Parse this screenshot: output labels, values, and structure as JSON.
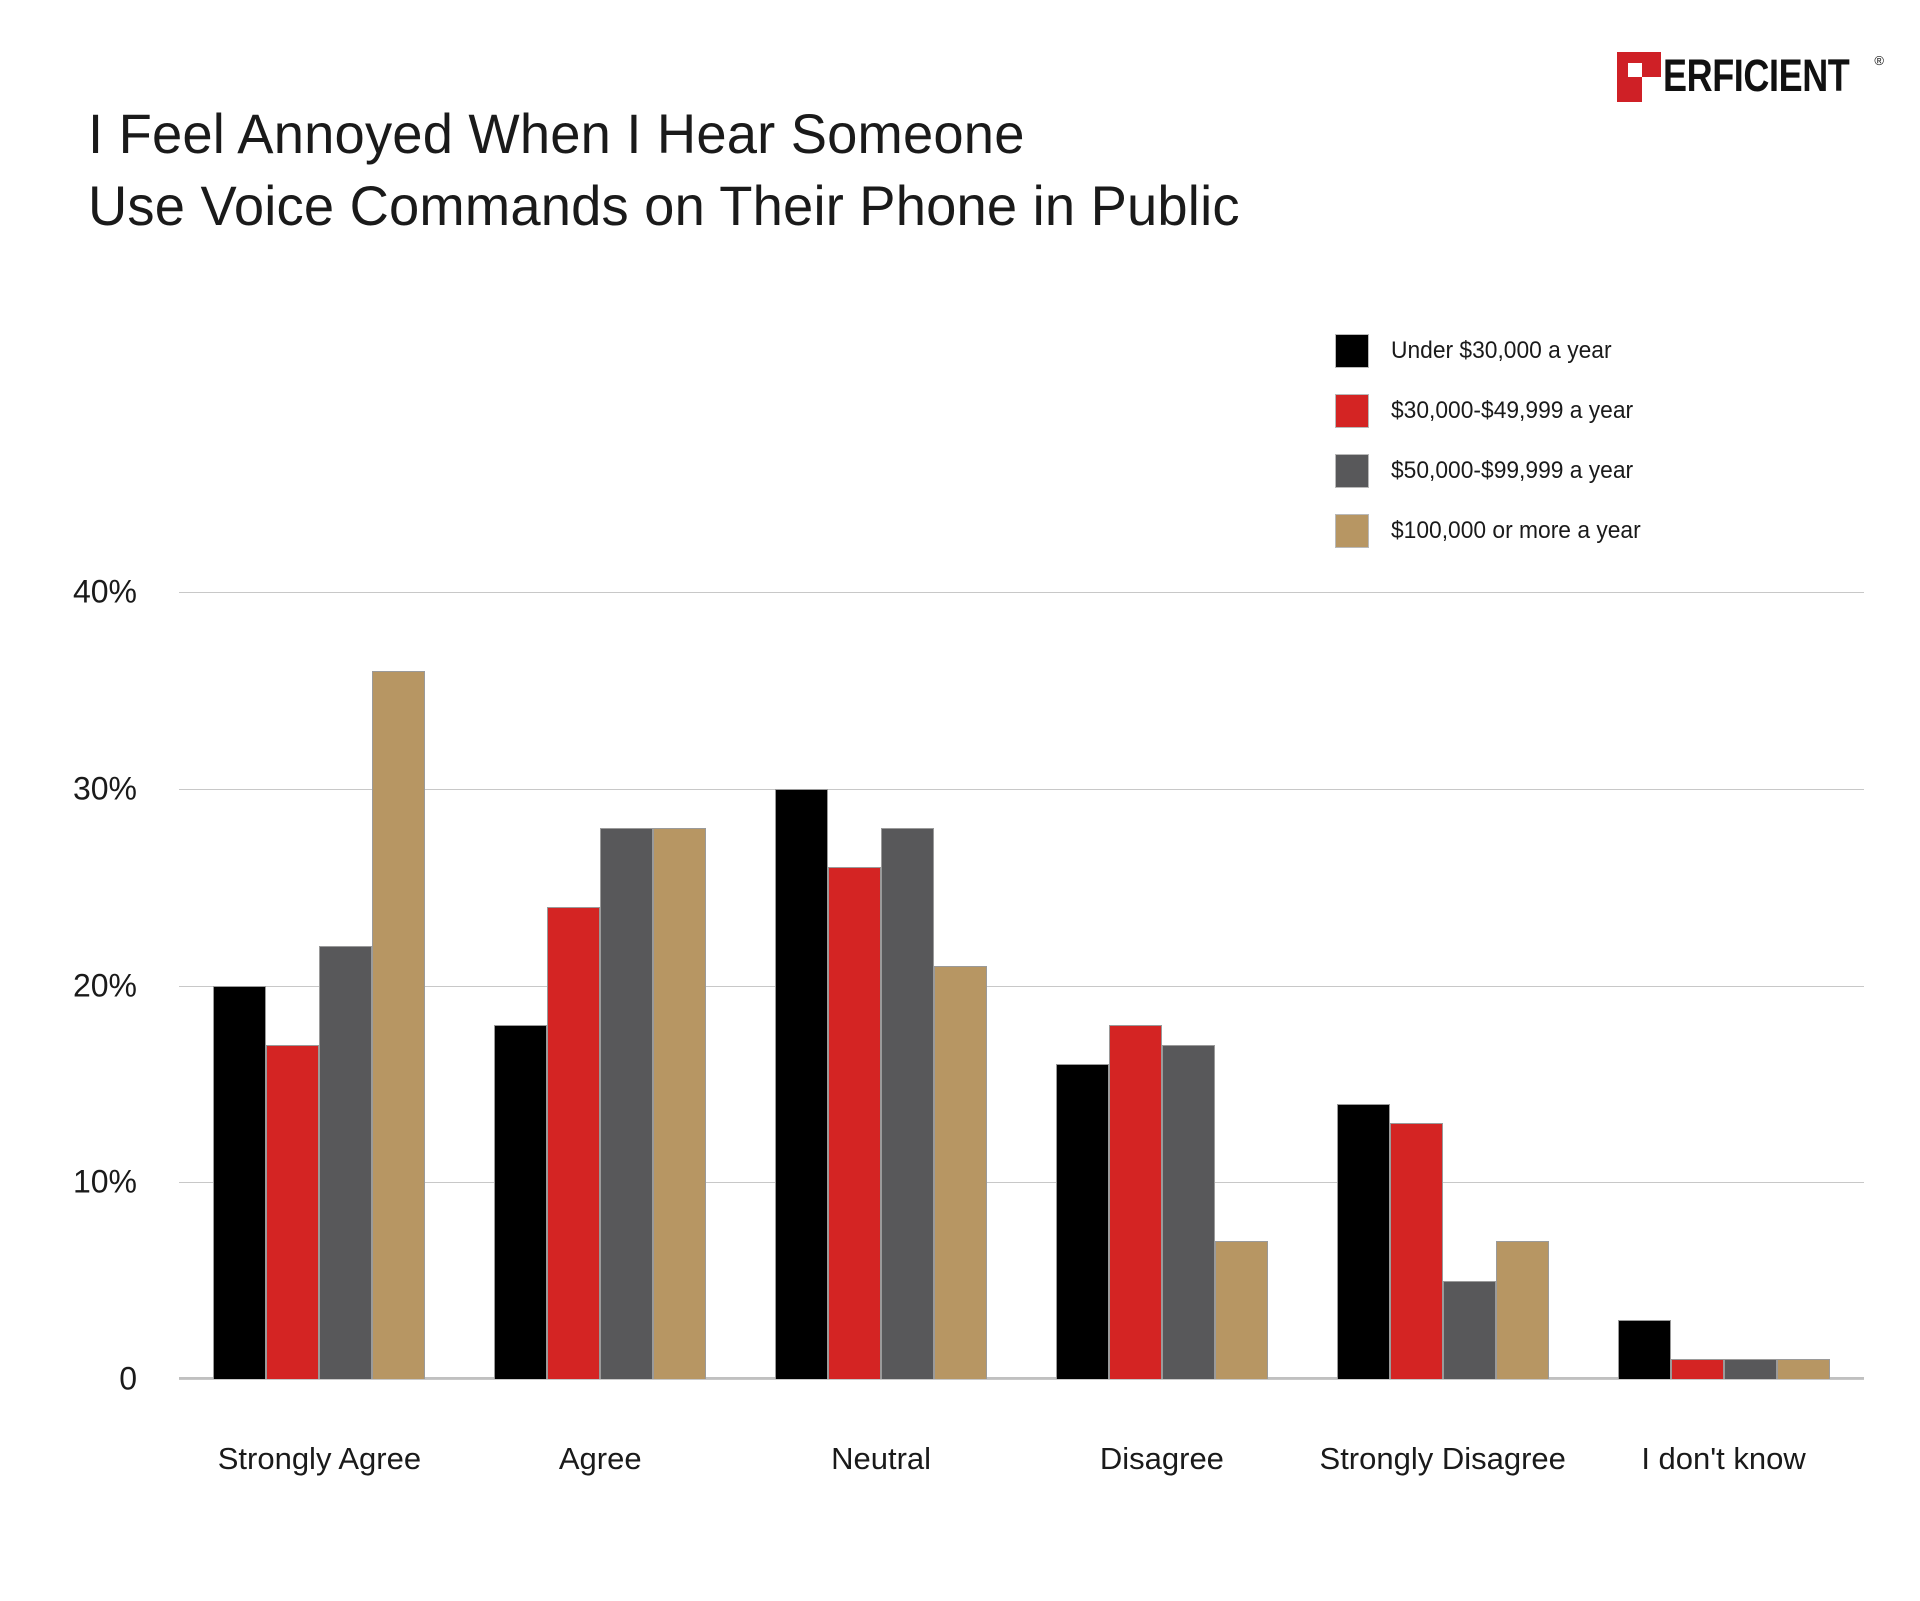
{
  "brand": {
    "logo_text": "ERFICIENT",
    "logo_mark": "P",
    "logo_registered": "®",
    "red": "#cf2026"
  },
  "title": {
    "line1": "I Feel Annoyed When I Hear Someone",
    "line2": "Use Voice Commands on Their Phone in Public"
  },
  "chart_data": {
    "type": "bar",
    "title": "I Feel Annoyed When I Hear Someone Use Voice Commands on Their Phone in Public",
    "xlabel": "",
    "ylabel": "",
    "ylim": [
      0,
      40
    ],
    "grid": true,
    "legend_position": "top-right",
    "ytick_labels": [
      "40%",
      "30%",
      "20%",
      "10%",
      "0"
    ],
    "yticks": [
      40,
      30,
      20,
      10,
      0
    ],
    "categories": [
      "Strongly Agree",
      "Agree",
      "Neutral",
      "Disagree",
      "Strongly Disagree",
      "I don't know"
    ],
    "series": [
      {
        "name": "Under $30,000 a year",
        "color": "#000000",
        "values": [
          20,
          18,
          30,
          16,
          14,
          3
        ]
      },
      {
        "name": "$30,000-$49,999 a year",
        "color": "#d42423",
        "values": [
          17,
          24,
          26,
          18,
          13,
          1
        ]
      },
      {
        "name": "$50,000-$99,999 a year",
        "color": "#58585a",
        "values": [
          22,
          28,
          28,
          17,
          5,
          1
        ]
      },
      {
        "name": "$100,000 or more a year",
        "color": "#b79663",
        "values": [
          36,
          28,
          21,
          7,
          7,
          1
        ]
      }
    ]
  }
}
